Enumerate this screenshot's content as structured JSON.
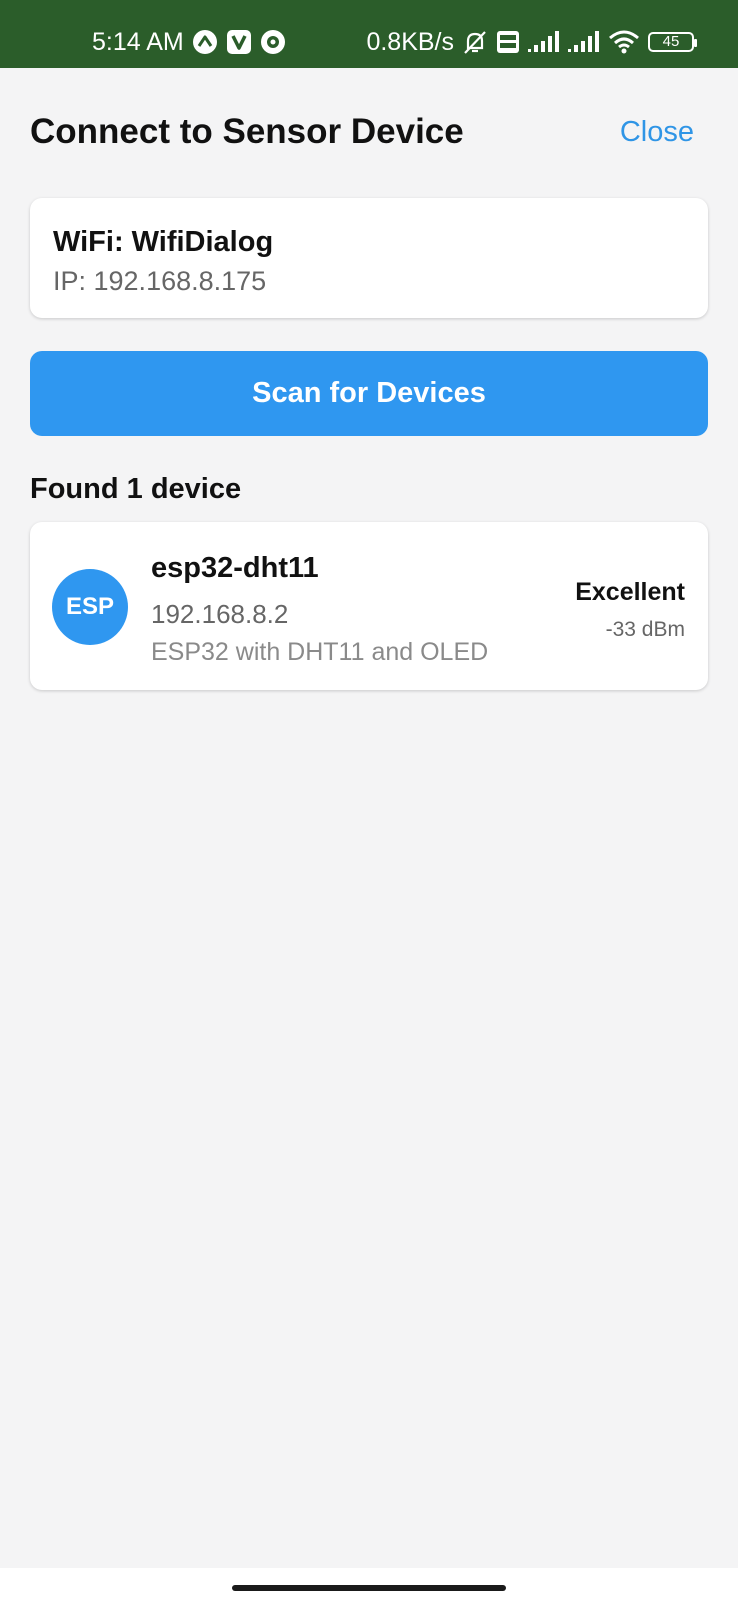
{
  "status_bar": {
    "time": "5:14 AM",
    "network_speed": "0.8KB/s",
    "battery_level": "45",
    "icons_left": [
      "vpn-icon",
      "v-app-icon",
      "shield-app-icon"
    ],
    "icons_right": [
      "mute-icon",
      "volte-icon",
      "signal-icon",
      "signal-icon",
      "wifi-icon",
      "battery-icon"
    ],
    "background": "#2b5d2a"
  },
  "header": {
    "title": "Connect to Sensor Device",
    "close_label": "Close",
    "accent_color": "#2f95e6"
  },
  "wifi_info": {
    "name": "WiFi: WifiDialog",
    "ip": "IP: 192.168.8.175"
  },
  "scan": {
    "label": "Scan for Devices",
    "color": "#2f97f0"
  },
  "results": {
    "found_label": "Found 1 device",
    "devices": [
      {
        "avatar": "ESP",
        "name": "esp32-dht11",
        "ip": "192.168.8.2",
        "description": "ESP32 with DHT11 and OLED",
        "quality": "Excellent",
        "strength": "-33 dBm"
      }
    ]
  }
}
